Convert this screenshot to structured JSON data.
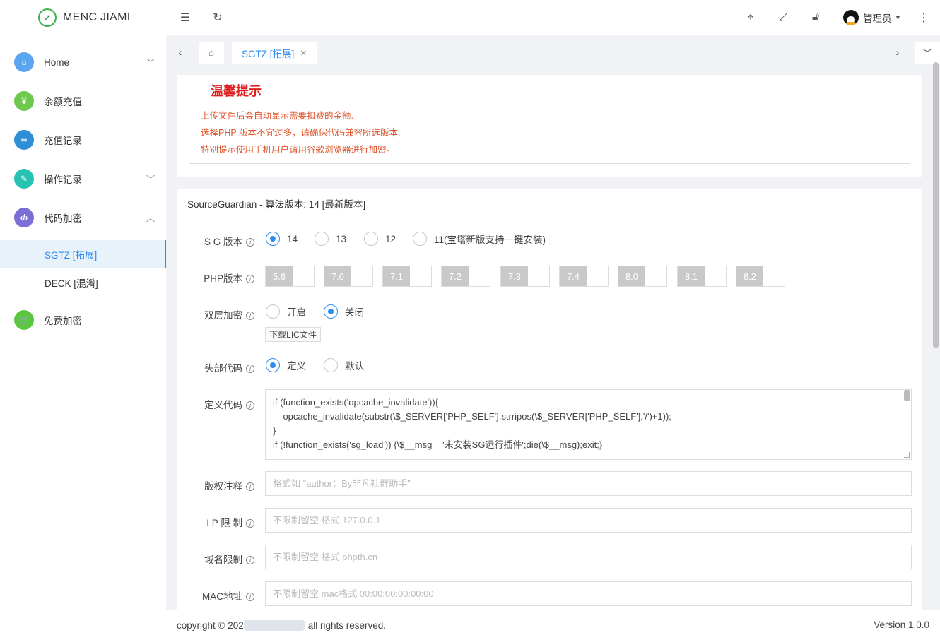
{
  "app": {
    "title": "MENC JIAMI"
  },
  "sidebar": {
    "items": [
      {
        "label": "Home",
        "icon": "home-icon",
        "color": "#5aa5f0"
      },
      {
        "label": "余额充值",
        "icon": "recharge-icon",
        "color": "#6cc94d"
      },
      {
        "label": "充值记录",
        "icon": "record-icon",
        "color": "#2e8fd6"
      },
      {
        "label": "操作记录",
        "icon": "log-icon",
        "color": "#28c2b4"
      },
      {
        "label": "代码加密",
        "icon": "code-icon",
        "color": "#7b6fd6"
      },
      {
        "label": "免费加密",
        "icon": "cart-icon",
        "color": "#5cc63e"
      }
    ],
    "sub": [
      {
        "label": "SGTZ [拓展]"
      },
      {
        "label": "DECK [混淆]"
      }
    ]
  },
  "header": {
    "user": "管理员"
  },
  "tabs": {
    "active": "SGTZ [拓展]"
  },
  "notice": {
    "title": "温馨提示",
    "lines": [
      "上传文件后会自动显示需要扣费的金额.",
      "选择PHP 版本不宜过多，请确保代码兼容所选版本.",
      "特别提示使用手机用户请用谷歌浏览器进行加密。"
    ]
  },
  "form": {
    "header": "SourceGuardian - 算法版本: 14 [最新版本]",
    "sg_label": "S G 版本",
    "sg_options": [
      "14",
      "13",
      "12",
      "11(宝塔新版支持一键安装)"
    ],
    "sg_selected": "14",
    "php_label": "PHP版本",
    "php_versions": [
      "5.6",
      "7.0",
      "7.1",
      "7.2",
      "7.3",
      "7.4",
      "8.0",
      "8.1",
      "8.2"
    ],
    "double_label": "双层加密",
    "double_options": [
      "开启",
      "关闭"
    ],
    "double_selected": "关闭",
    "lic_button": "下载LIC文件",
    "head_label": "头部代码",
    "head_options": [
      "定义",
      "默认"
    ],
    "head_selected": "定义",
    "code_label": "定义代码",
    "code_lines": [
      "if (function_exists('opcache_invalidate')){",
      "    opcache_invalidate(substr(\\$_SERVER['PHP_SELF'],strripos(\\$_SERVER['PHP_SELF'],'/')+1));",
      "}",
      "if (!function_exists('sg_load')) {\\$__msg = '未安装SG运行插件';die(\\$__msg);exit;}"
    ],
    "copyright_label": "版权注释",
    "copyright_placeholder": "格式如 \"author：By非凡社群助手\"",
    "ip_label": "I P 限 制",
    "ip_placeholder": "不限制留空 格式 127.0.0.1",
    "domain_label": "域名限制",
    "domain_placeholder": "不限制留空 格式 phpth.cn",
    "mac_label": "MAC地址",
    "mac_placeholder": "不限制留空 mac格式 00:00:00:00:00:00"
  },
  "footer": {
    "copy_prefix": "copyright © 202",
    "copy_suffix": "all rights reserved.",
    "version": "Version 1.0.0"
  },
  "colors": {
    "primary": "#2d8cf0",
    "notice_text": "#e0532a",
    "notice_title": "#e02020"
  }
}
